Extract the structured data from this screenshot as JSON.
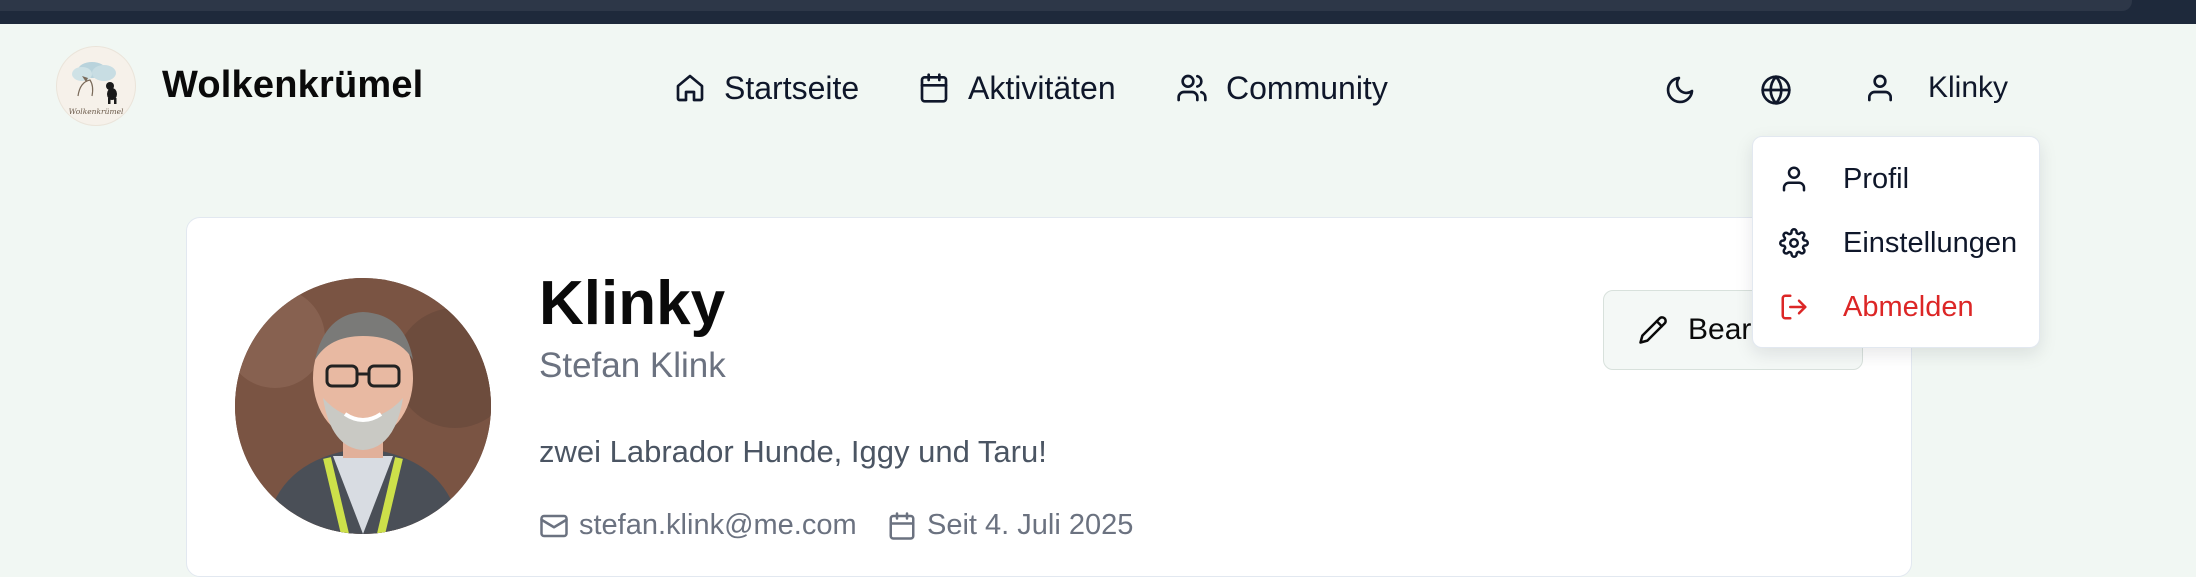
{
  "app": {
    "brand": "Wolkenkrümel",
    "logo_text": "Wolkenkrümel",
    "accent_color": "#dc2626"
  },
  "nav": {
    "items": [
      {
        "label": "Startseite",
        "icon": "home-icon"
      },
      {
        "label": "Aktivitäten",
        "icon": "calendar-icon"
      },
      {
        "label": "Community",
        "icon": "users-icon"
      }
    ],
    "theme_toggle_icon": "moon-icon",
    "language_icon": "globe-icon",
    "user": {
      "label": "Klinky",
      "icon": "user-icon"
    }
  },
  "user_menu": {
    "items": [
      {
        "label": "Profil",
        "icon": "user-icon"
      },
      {
        "label": "Einstellungen",
        "icon": "gear-icon"
      },
      {
        "label": "Abmelden",
        "icon": "logout-icon",
        "color": "#dc2626"
      }
    ]
  },
  "profile": {
    "username": "Klinky",
    "full_name": "Stefan Klink",
    "bio": "zwei Labrador Hunde, Iggy und Taru!",
    "email": "stefan.klink@me.com",
    "member_since": "Seit 4. Juli 2025",
    "edit_label": "Bearbeiten"
  }
}
